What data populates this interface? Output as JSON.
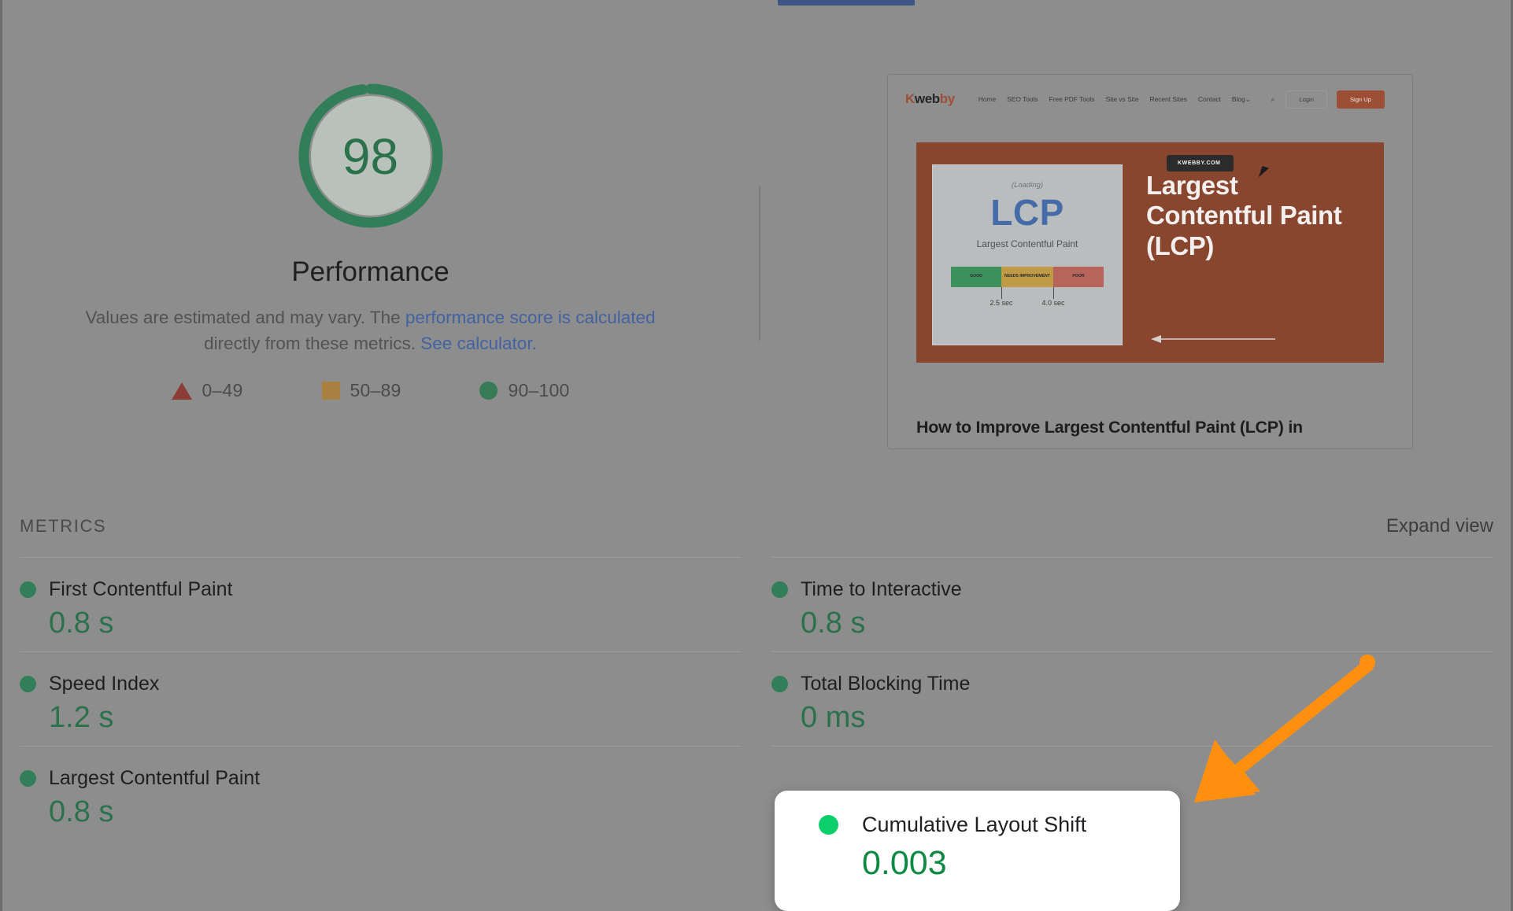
{
  "theme": {
    "page_background": "#8d8d8d",
    "tab_indicator_color": "#2f55a4",
    "score_green": "#0b7c3e",
    "callout_dot_green": "#0cce6b",
    "link_blue": "#3063c9",
    "annotation_orange": "#ff900f",
    "brand_orange": "#c4461c"
  },
  "gauge": {
    "score": "98",
    "title": "Performance",
    "description_part1": "Values are estimated and may vary. The ",
    "description_link1": "performance score is calculated",
    "description_part2": " directly from these metrics. ",
    "description_link2": "See calculator."
  },
  "legend": {
    "items": [
      {
        "icon": "triangle-icon",
        "label": "0–49",
        "color": "#b4332a"
      },
      {
        "icon": "square-icon",
        "label": "50–89",
        "color": "#bd7f17"
      },
      {
        "icon": "circle-icon",
        "label": "90–100",
        "color": "#13864b"
      }
    ]
  },
  "thumbnail": {
    "caption": "How to Improve Largest Contentful Paint (LCP) in",
    "site": {
      "logo_k": "K",
      "logo_web": "web",
      "logo_by": "by",
      "nav_links": [
        "Home",
        "SEO Tools",
        "Free PDF Tools",
        "Site vs Site",
        "Recent Sites",
        "Contact",
        "Blog⌄"
      ],
      "search_icon": "⌕",
      "login_label": "Login",
      "signup_label": "Sign Up"
    },
    "hero": {
      "watermark": "KWEBBY.COM",
      "headline": "Largest Contentful Paint (LCP)",
      "card": {
        "loading_label": "(Loading)",
        "acronym": "LCP",
        "subtitle": "Largest Contentful Paint",
        "segments": [
          {
            "label": "GOOD",
            "color": "#15a04a"
          },
          {
            "label": "NEEDS IMPROVEMENT",
            "color": "#d59a10"
          },
          {
            "label": "POOR",
            "color": "#df5b49"
          }
        ],
        "ticks": [
          "2.5 sec",
          "4.0 sec"
        ]
      }
    }
  },
  "metrics_section": {
    "title": "METRICS",
    "expand_label": "Expand view",
    "left_column": [
      {
        "label": "First Contentful Paint",
        "value": "0.8 s",
        "status": "good"
      },
      {
        "label": "Speed Index",
        "value": "1.2 s",
        "status": "good"
      },
      {
        "label": "Largest Contentful Paint",
        "value": "0.8 s",
        "status": "good"
      }
    ],
    "right_column": [
      {
        "label": "Time to Interactive",
        "value": "0.8 s",
        "status": "good"
      },
      {
        "label": "Total Blocking Time",
        "value": "0 ms",
        "status": "good"
      }
    ]
  },
  "callout": {
    "label": "Cumulative Layout Shift",
    "value": "0.003",
    "status": "good"
  }
}
